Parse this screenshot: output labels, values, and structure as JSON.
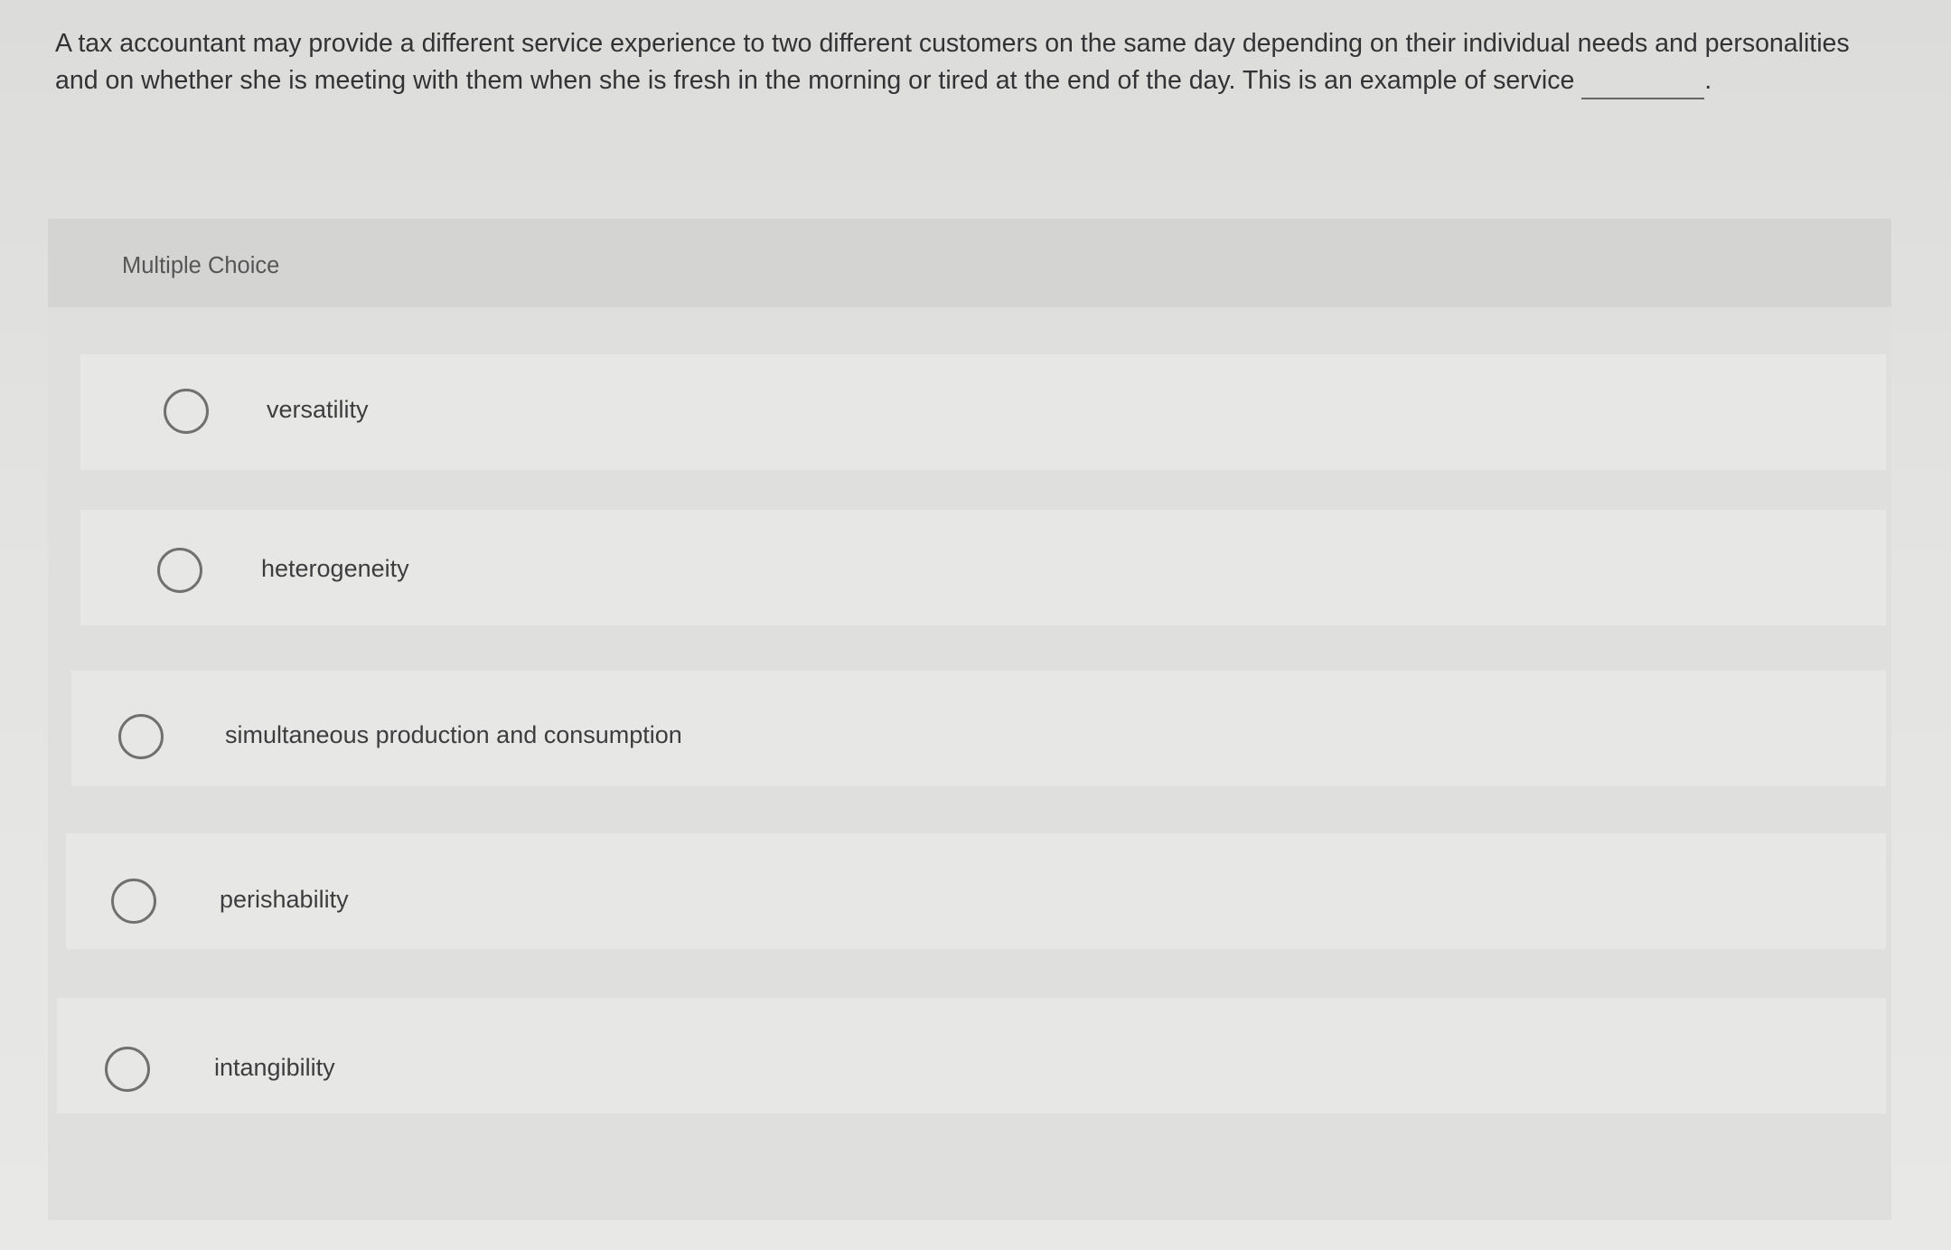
{
  "question": {
    "text": "A tax accountant may provide a different service experience to two different customers on the same day depending on their individual needs and personalities and on whether she is meeting with them when she is fresh in the morning or tired at the end of the day. This is an example of service",
    "blank_suffix": "."
  },
  "card": {
    "header_label": "Multiple Choice"
  },
  "choices": [
    {
      "label": "versatility",
      "selected": false
    },
    {
      "label": "heterogeneity",
      "selected": false
    },
    {
      "label": "simultaneous production and consumption",
      "selected": false
    },
    {
      "label": "perishability",
      "selected": false
    },
    {
      "label": "intangibility",
      "selected": false
    }
  ],
  "colors": {
    "background": "#e3e3e1",
    "card": "#dfdfdd",
    "card_header": "#d4d4d2",
    "choice_row": "#e7e7e5",
    "text": "#333336",
    "radio_border": "#707070"
  },
  "icons": {
    "radio": "radio-button-unchecked-icon"
  }
}
